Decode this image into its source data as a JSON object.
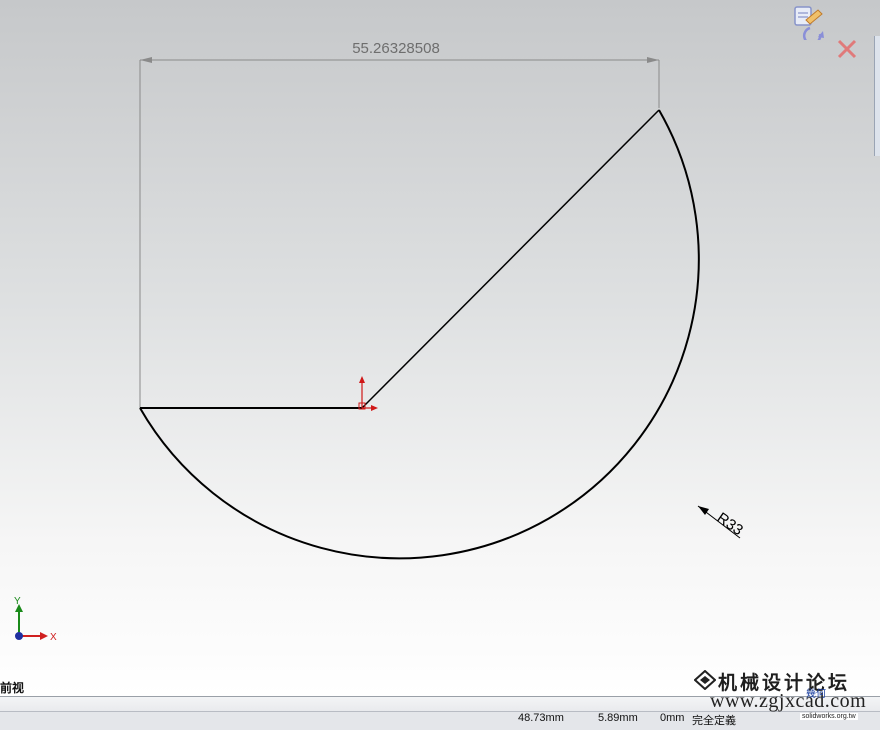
{
  "sketch": {
    "dimension_value": "55.26328508",
    "radius_label": "R33"
  },
  "triad": {
    "y_label": "Y",
    "x_label": "X"
  },
  "view": {
    "name": "前视"
  },
  "status_bar": {
    "x_coord": "48.73mm",
    "y_coord": "5.89mm",
    "z_coord": "0mm",
    "sketch_state": "完全定義"
  },
  "watermark": {
    "title": "机械设计论坛",
    "url": "www.zgjxcad.com",
    "badge": "幾何",
    "small": "solidworks.org.tw"
  },
  "colors": {
    "geometry": "#000000",
    "origin": "#d01818",
    "dimension": "#6e6e6e",
    "triad_y": "#1a8a1a",
    "triad_x": "#d02020",
    "triad_origin": "#2030a0"
  }
}
